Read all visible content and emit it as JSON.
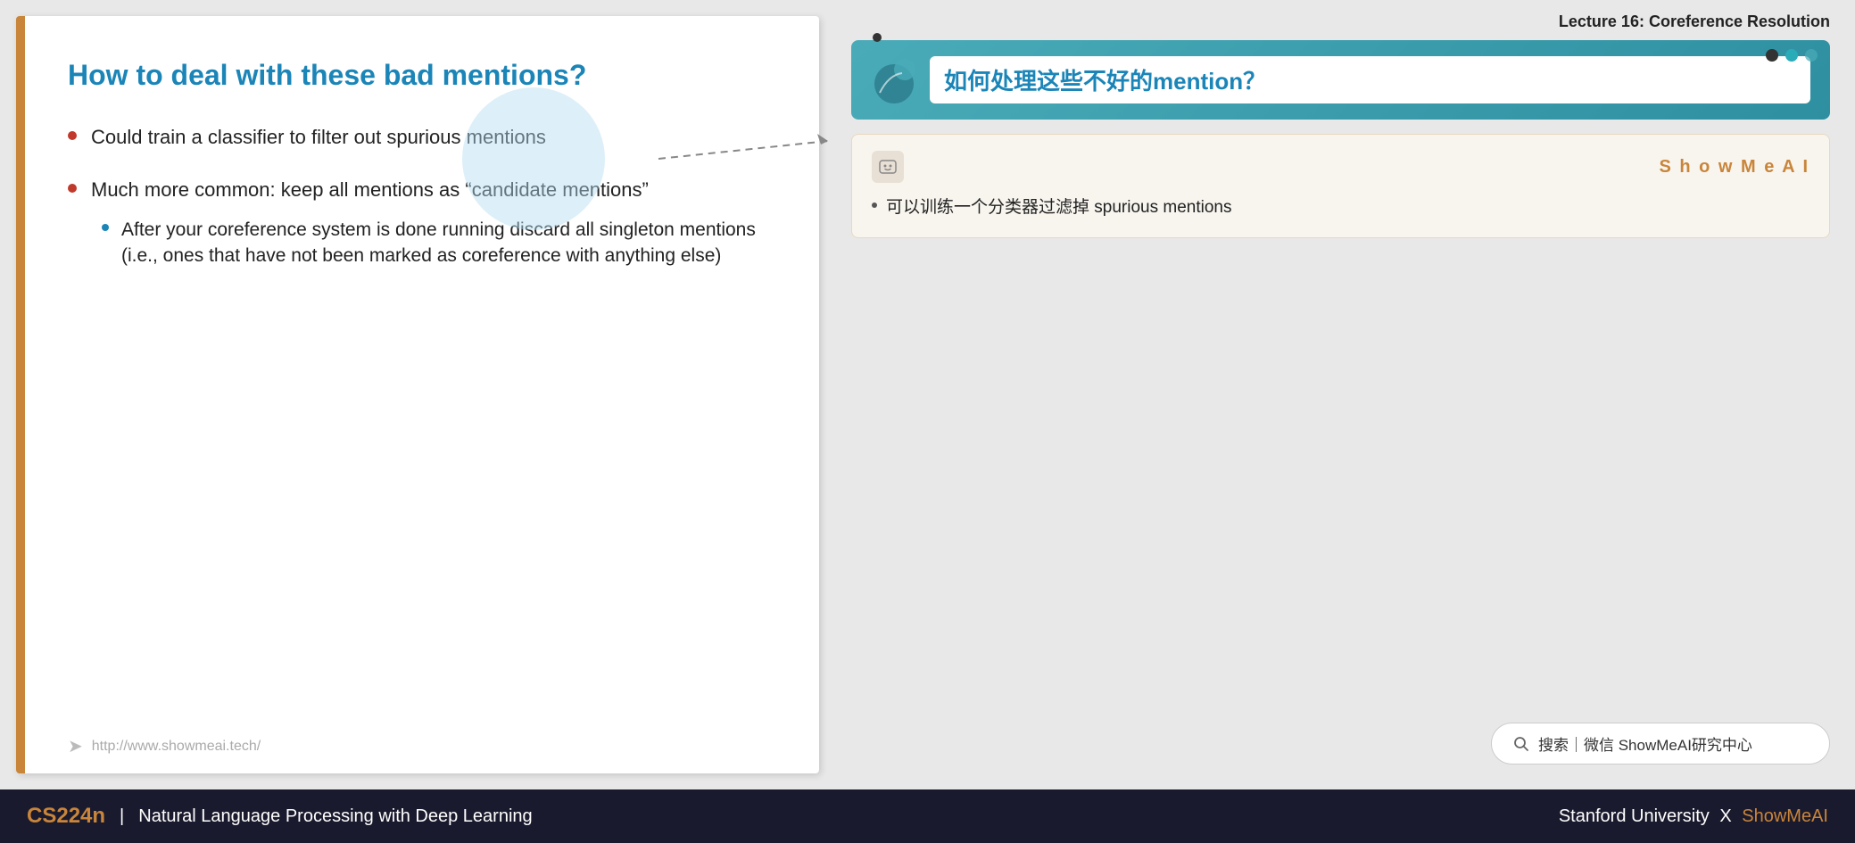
{
  "header": {
    "lecture_title": "Lecture 16: Coreference Resolution"
  },
  "slide": {
    "title": "How to deal with these bad mentions?",
    "bullets": [
      {
        "text": "Could train a classifier to filter out spurious mentions",
        "sub_bullets": []
      },
      {
        "text": "Much more common: keep all mentions as “candidate mentions”",
        "sub_bullets": [
          "After your coreference system is done running discard all singleton mentions (i.e., ones that have not been marked as coreference with anything else)"
        ]
      }
    ],
    "footer_url": "http://www.showmeai.tech/"
  },
  "right_panel": {
    "zh_title": "如何处理这些不好的mention？",
    "showmeai_brand": "S h o w M e A I",
    "translation_bullet": "可以训练一个分类器过滤掉 spurious mentions",
    "dots": [
      "dark",
      "teal",
      "light-teal"
    ]
  },
  "search_bar": {
    "icon": "search",
    "text": "搜索｜微信 ShowMeAI研究中心"
  },
  "bottom_bar": {
    "course_code": "CS224n",
    "divider": "|",
    "course_name": "Natural Language Processing with Deep Learning",
    "university": "Stanford University",
    "x_mark": "X",
    "brand": "ShowMeAI"
  }
}
